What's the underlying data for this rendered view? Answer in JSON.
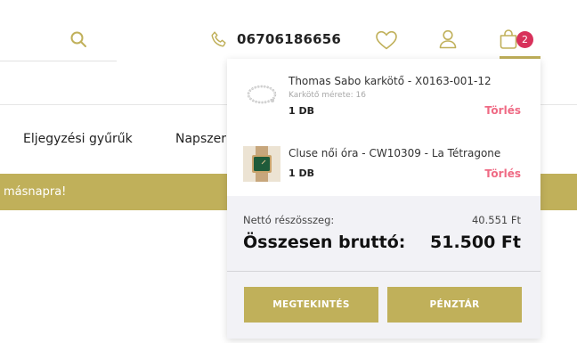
{
  "header": {
    "phone": "06706186656",
    "cart_count": "2",
    "icons": [
      "search-icon",
      "phone-icon",
      "heart-icon",
      "user-icon",
      "bag-icon"
    ],
    "accent_color": "#c0b05a",
    "badge_color": "#d8315b"
  },
  "nav": {
    "items": [
      {
        "label": "Eljegyzési gyűrűk"
      },
      {
        "label": "Napszer"
      }
    ]
  },
  "promo": {
    "text": "másnapra!"
  },
  "mini_cart": {
    "items": [
      {
        "name": "Thomas Sabo karkötő - X0163-001-12",
        "sub": "Karkötő mérete: 16",
        "qty": "1 DB",
        "delete_label": "Törlés"
      },
      {
        "name": "Cluse női óra - CW10309 - La Tétragone",
        "qty": "1 DB",
        "delete_label": "Törlés"
      }
    ],
    "net_label": "Nettó részösszeg:",
    "net_value": "40.551 Ft",
    "gross_label": "Összesen bruttó:",
    "gross_value": "51.500 Ft",
    "view_button": "MEGTEKINTÉS",
    "checkout_button": "PÉNZTÁR",
    "delete_color": "#ef6a84"
  }
}
